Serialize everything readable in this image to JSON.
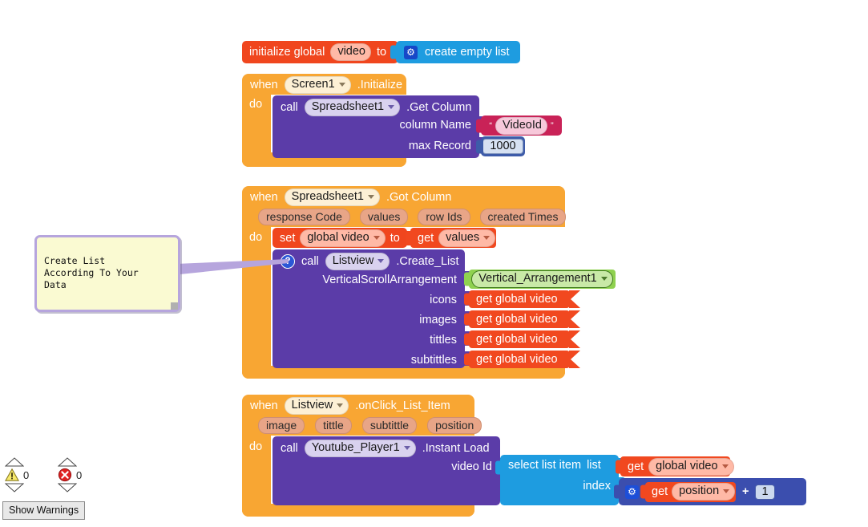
{
  "workspace": {
    "comment": {
      "text": "Create List\nAccording To Your\nData"
    },
    "status": {
      "warning_icon": "warning-triangle-icon",
      "warning_count": "0",
      "error_icon": "error-circle-icon",
      "error_count": "0",
      "show_warnings_label": "Show Warnings"
    }
  },
  "blocks": {
    "init_global": {
      "keyword": "initialize global",
      "name": "video",
      "to": "to",
      "value": {
        "gear_icon": "mutator-gear-icon",
        "label": "create empty list"
      }
    },
    "screen_init": {
      "when": "when",
      "component": "Screen1",
      "event": ".Initialize",
      "do": "do",
      "body": {
        "call": "call",
        "component": "Spreadsheet1",
        "method": ".Get Column",
        "args": [
          {
            "label": "column Name",
            "value": "VideoId",
            "type": "text"
          },
          {
            "label": "max Record",
            "value": "1000",
            "type": "number"
          }
        ]
      }
    },
    "got_column": {
      "when": "when",
      "component": "Spreadsheet1",
      "event": ".Got Column",
      "params": [
        "response Code",
        "values",
        "row Ids",
        "created Times"
      ],
      "do": "do",
      "set_block": {
        "set": "set",
        "variable": "global video",
        "to": "to",
        "value": {
          "get": "get",
          "variable": "values"
        }
      },
      "call_block": {
        "help_icon": "help-question-icon",
        "call": "call",
        "component": "Listview",
        "method": ".Create_List",
        "args": [
          {
            "label": "VerticalScrollArrangement",
            "value": "Vertical_Arrangement1",
            "type": "component"
          },
          {
            "label": "icons",
            "value": "get global video",
            "type": "variable"
          },
          {
            "label": "images",
            "value": "get global video",
            "type": "variable"
          },
          {
            "label": "tittles",
            "value": "get global video",
            "type": "variable"
          },
          {
            "label": "subtittles",
            "value": "get global video",
            "type": "variable"
          }
        ]
      }
    },
    "on_click": {
      "when": "when",
      "component": "Listview",
      "event": ".onClick_List_Item",
      "params": [
        "image",
        "tittle",
        "subtittle",
        "position"
      ],
      "do": "do",
      "call_block": {
        "call": "call",
        "component": "Youtube_Player1",
        "method": ".Instant Load",
        "arg_label": "video Id"
      },
      "select_list_item": {
        "label": "select list item",
        "list_label": "list",
        "list_value": {
          "get": "get",
          "variable": "global video"
        },
        "index_label": "index",
        "index_value": {
          "gear_icon": "mutator-gear-icon",
          "left": {
            "get": "get",
            "variable": "position"
          },
          "operator": "+",
          "right": "1"
        }
      }
    }
  },
  "colors": {
    "event_orange": "#F8A633",
    "call_purple": "#5B3CA8",
    "variable_red": "#F0461E",
    "list_blue": "#1E9CE0",
    "math_blue": "#3B4EAE",
    "text_magenta": "#C92257",
    "component_green": "#8FD14F"
  }
}
